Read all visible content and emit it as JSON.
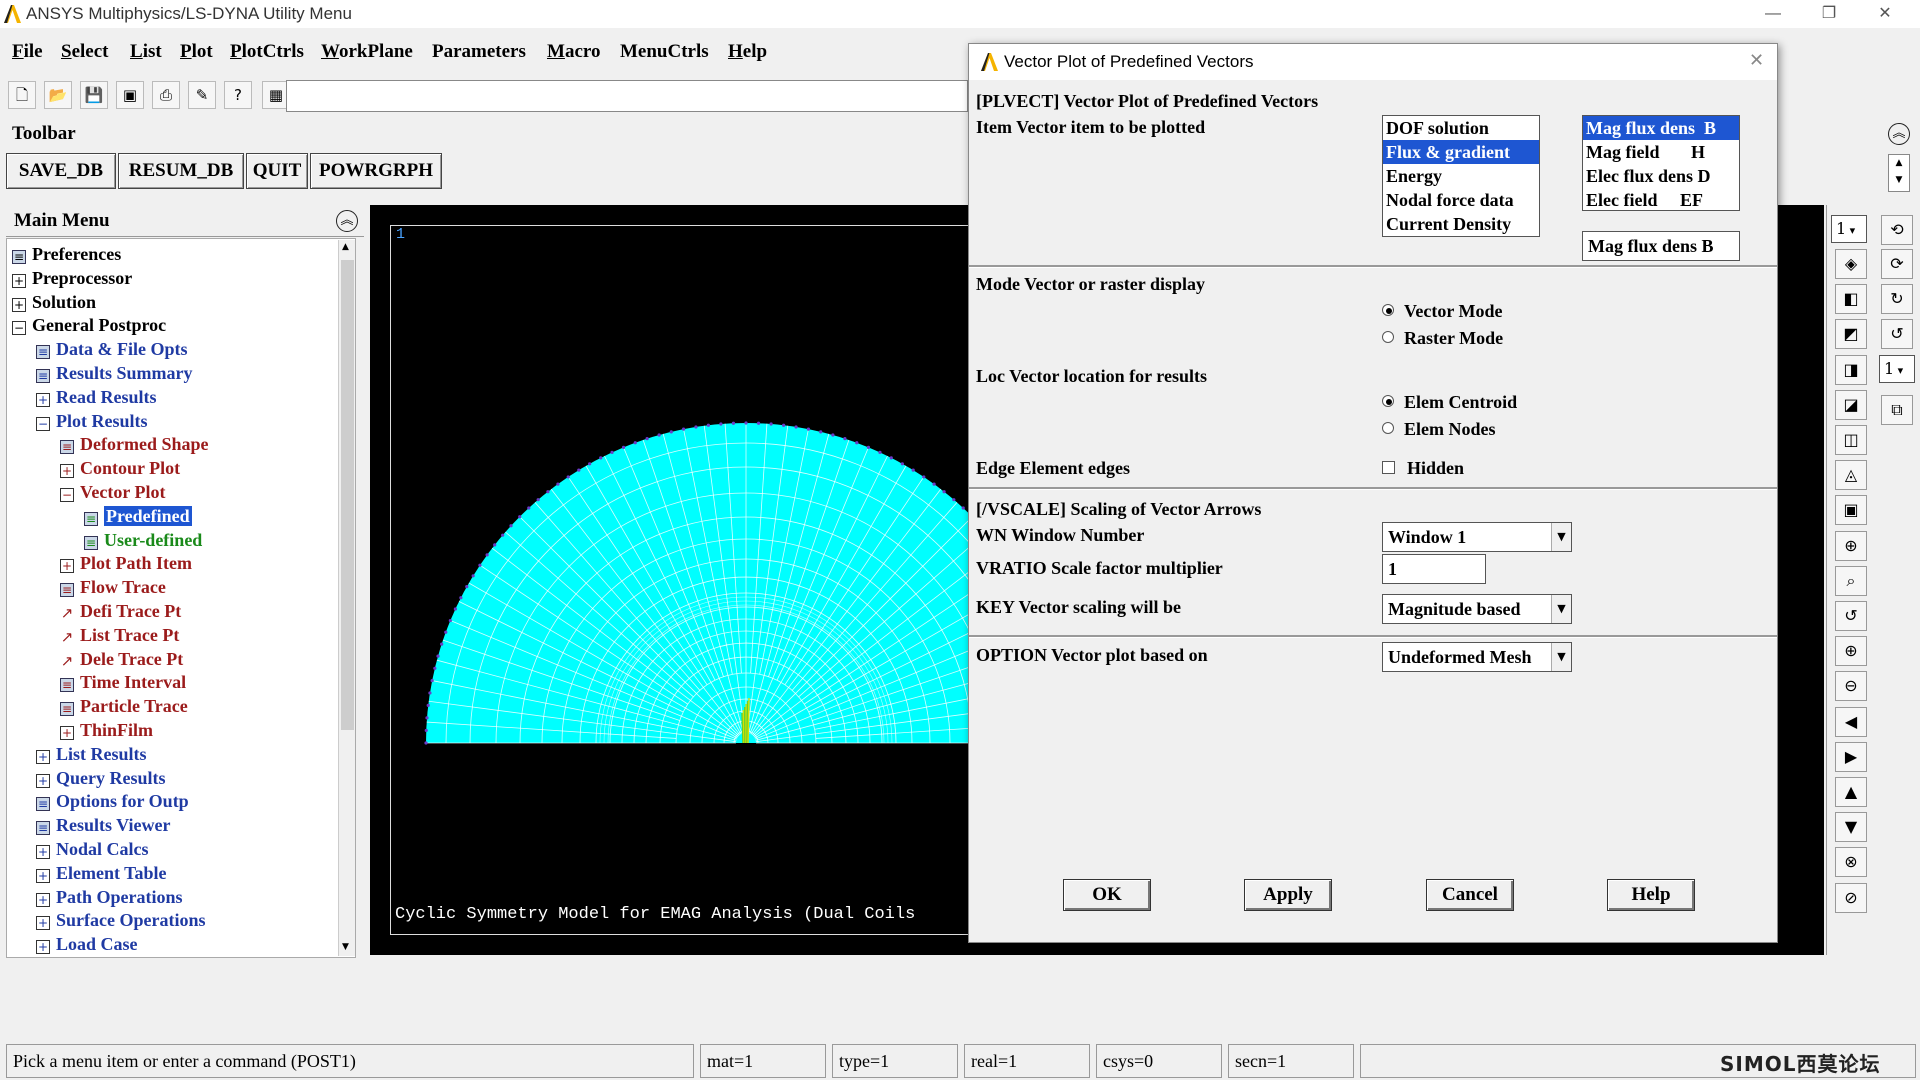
{
  "window": {
    "title": "ANSYS Multiphysics/LS-DYNA Utility Menu",
    "controls": {
      "minimize": "—",
      "restore": "❐",
      "close": "✕"
    }
  },
  "menubar": [
    {
      "label": "File",
      "key": "F",
      "rest": "ile"
    },
    {
      "label": "Select",
      "key": "S",
      "rest": "elect"
    },
    {
      "label": "List",
      "key": "L",
      "rest": "ist"
    },
    {
      "label": "Plot",
      "key": "P",
      "rest": "lot"
    },
    {
      "label": "PlotCtrls",
      "key": "P",
      "rest": "lotCtrls"
    },
    {
      "label": "WorkPlane",
      "key": "W",
      "rest": "orkPlane"
    },
    {
      "label": "Parameters",
      "key": "",
      "rest": "Parameters"
    },
    {
      "label": "Macro",
      "key": "M",
      "rest": "acro"
    },
    {
      "label": "MenuCtrls",
      "key": "",
      "rest": "MenuCtrls"
    },
    {
      "label": "Help",
      "key": "H",
      "rest": "elp"
    }
  ],
  "icon_toolbar": [
    {
      "name": "new-file-icon",
      "glyph": "🗋"
    },
    {
      "name": "open-folder-icon",
      "glyph": "📂"
    },
    {
      "name": "save-icon",
      "glyph": "💾"
    },
    {
      "name": "save-as-icon",
      "glyph": "▣"
    },
    {
      "name": "print-icon",
      "glyph": "⎙"
    },
    {
      "name": "report-icon",
      "glyph": "✎"
    },
    {
      "name": "help-icon",
      "glyph": "?"
    },
    {
      "name": "command-window-icon",
      "glyph": "▦"
    }
  ],
  "command_input": {
    "value": ""
  },
  "toolbar": {
    "label": "Toolbar",
    "buttons": [
      "SAVE_DB",
      "RESUM_DB",
      "QUIT",
      "POWRGRPH"
    ]
  },
  "main_menu": {
    "title": "Main Menu",
    "items": [
      {
        "label": "Preferences",
        "level": 0,
        "icon": "doc",
        "color": "c0"
      },
      {
        "label": "Preprocessor",
        "level": 0,
        "icon": "plus",
        "color": "c0"
      },
      {
        "label": "Solution",
        "level": 0,
        "icon": "plus",
        "color": "c0"
      },
      {
        "label": "General Postproc",
        "level": 0,
        "icon": "minus",
        "color": "c0"
      },
      {
        "label": "Data & File Opts",
        "level": 1,
        "icon": "doc",
        "color": "c1"
      },
      {
        "label": "Results Summary",
        "level": 1,
        "icon": "doc",
        "color": "c1"
      },
      {
        "label": "Read Results",
        "level": 1,
        "icon": "plus",
        "color": "c1"
      },
      {
        "label": "Plot Results",
        "level": 1,
        "icon": "minus",
        "color": "c1"
      },
      {
        "label": "Deformed Shape",
        "level": 2,
        "icon": "doc",
        "color": "c2"
      },
      {
        "label": "Contour Plot",
        "level": 2,
        "icon": "plus",
        "color": "c2"
      },
      {
        "label": "Vector Plot",
        "level": 2,
        "icon": "minus",
        "color": "c2"
      },
      {
        "label": "Predefined",
        "level": 3,
        "icon": "doc",
        "color": "c3",
        "selected": true
      },
      {
        "label": "User-defined",
        "level": 3,
        "icon": "doc",
        "color": "c3"
      },
      {
        "label": "Plot Path Item",
        "level": 2,
        "icon": "plus",
        "color": "c2"
      },
      {
        "label": "Flow Trace",
        "level": 2,
        "icon": "doc",
        "color": "c2"
      },
      {
        "label": "Defi Trace Pt",
        "level": 2,
        "icon": "arrow",
        "color": "c2"
      },
      {
        "label": "List Trace Pt",
        "level": 2,
        "icon": "arrow",
        "color": "c2"
      },
      {
        "label": "Dele Trace Pt",
        "level": 2,
        "icon": "arrow",
        "color": "c2"
      },
      {
        "label": "Time Interval",
        "level": 2,
        "icon": "doc",
        "color": "c2"
      },
      {
        "label": "Particle Trace",
        "level": 2,
        "icon": "doc",
        "color": "c2"
      },
      {
        "label": "ThinFilm",
        "level": 2,
        "icon": "plus",
        "color": "c2"
      },
      {
        "label": "List Results",
        "level": 1,
        "icon": "plus",
        "color": "c1"
      },
      {
        "label": "Query Results",
        "level": 1,
        "icon": "plus",
        "color": "c1"
      },
      {
        "label": "Options for Outp",
        "level": 1,
        "icon": "doc",
        "color": "c1"
      },
      {
        "label": "Results Viewer",
        "level": 1,
        "icon": "doc",
        "color": "c1"
      },
      {
        "label": "Nodal Calcs",
        "level": 1,
        "icon": "plus",
        "color": "c1"
      },
      {
        "label": "Element Table",
        "level": 1,
        "icon": "plus",
        "color": "c1"
      },
      {
        "label": "Path Operations",
        "level": 1,
        "icon": "plus",
        "color": "c1"
      },
      {
        "label": "Surface Operations",
        "level": 1,
        "icon": "plus",
        "color": "c1"
      },
      {
        "label": "Load Case",
        "level": 1,
        "icon": "plus",
        "color": "c1"
      }
    ]
  },
  "graphics": {
    "window_number": "1",
    "caption": "Cyclic Symmetry Model for EMAG Analysis (Dual Coils",
    "mesh_color": "#00ffff",
    "background": "#000000"
  },
  "right_toolbar": {
    "window_select_1": "1",
    "window_select_2": "1",
    "icons": [
      "iso-view-icon",
      "front-view-icon",
      "top-view-icon",
      "back-view-icon",
      "right-view-icon",
      "left-view-icon",
      "bottom-view-icon",
      "oblique-view-icon",
      "zoom-icon",
      "box-zoom-icon",
      "win-zoom-icon",
      "zoom-in-icon",
      "zoom-out-icon",
      "pan-left-icon",
      "pan-right-icon",
      "pan-up-icon",
      "pan-down-icon",
      "rotate-x-icon",
      "rotate-y-icon"
    ],
    "side_icons": [
      "dynamic-mode-icon",
      "rotate-z-icon",
      "rotate-z-neg-icon",
      "rotate-y-neg-icon",
      "reset-icon"
    ]
  },
  "status": {
    "prompt": "Pick a menu item or enter a command (POST1)",
    "mat": "mat=1",
    "type": "type=1",
    "real": "real=1",
    "csys": "csys=0",
    "secn": "secn=1",
    "brand": "SIMOL西莫论坛"
  },
  "dialog": {
    "title": "Vector Plot of Predefined Vectors",
    "heading": "[PLVECT]  Vector Plot of Predefined Vectors",
    "item_label": "Item  Vector item to be plotted",
    "item_categories": [
      "DOF solution",
      "Flux & gradient",
      "Energy",
      "Nodal force data",
      "Current Density"
    ],
    "item_category_selected": 1,
    "item_components": [
      "Mag flux dens  B",
      "Mag field       H",
      "Elec flux dens D",
      "Elec field     EF"
    ],
    "item_component_selected": 0,
    "item_value": "Mag flux dens  B",
    "mode_label": "Mode  Vector or raster display",
    "mode_options": [
      "Vector Mode",
      "Raster Mode"
    ],
    "mode_selected": 0,
    "loc_label": "Loc  Vector location for results",
    "loc_options": [
      "Elem Centroid",
      "Elem Nodes"
    ],
    "loc_selected": 0,
    "edge_label": "Edge Element edges",
    "edge_option": "Hidden",
    "edge_checked": false,
    "vscale_heading": "[/VSCALE] Scaling of Vector Arrows",
    "wn_label": "WN  Window Number",
    "wn_value": "Window 1",
    "vratio_label": "VRATIO  Scale factor multiplier",
    "vratio_value": "1",
    "key_label": "KEY     Vector scaling will be",
    "key_value": "Magnitude based",
    "option_label": "OPTION  Vector plot based on",
    "option_value": "Undeformed Mesh",
    "buttons": {
      "ok": "OK",
      "apply": "Apply",
      "cancel": "Cancel",
      "help": "Help"
    }
  }
}
